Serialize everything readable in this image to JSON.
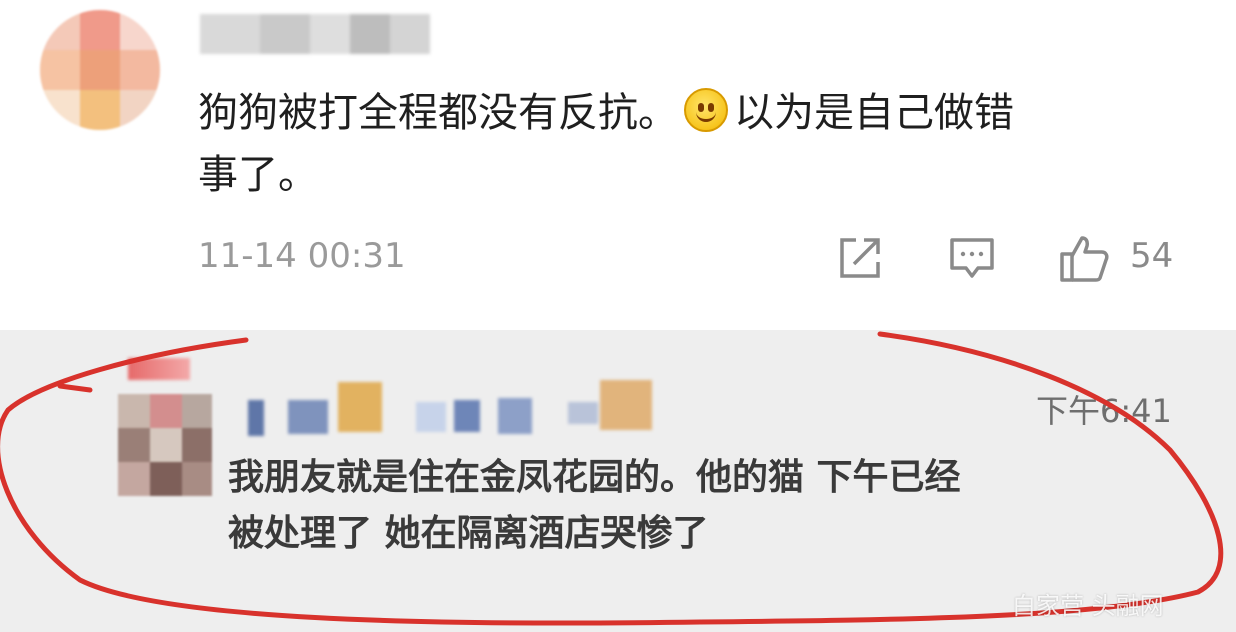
{
  "top_comment": {
    "text_line1_part1": "狗狗被打全程都没有反抗。",
    "emoji": "smile-emoji",
    "text_line1_part2": "以为是自己做错",
    "text_line2": "事了。",
    "timestamp": "11-14 00:31",
    "actions": {
      "share_icon": "share-icon",
      "comment_icon": "comment-icon",
      "like_icon": "thumbs-up-icon",
      "like_count": "54"
    }
  },
  "screenshot_comment": {
    "time": "下午6:41",
    "text_line1": "我朋友就是住在金凤花园的。他的猫 下午已经",
    "text_line2": "被处理了 她在隔离酒店哭惨了",
    "watermark": "白家营 头融网"
  },
  "colors": {
    "annotation_ring": "#d8322c",
    "text_primary": "#1f1f1f",
    "text_muted": "#9a9a9a",
    "panel_bg": "#eeeeee"
  }
}
